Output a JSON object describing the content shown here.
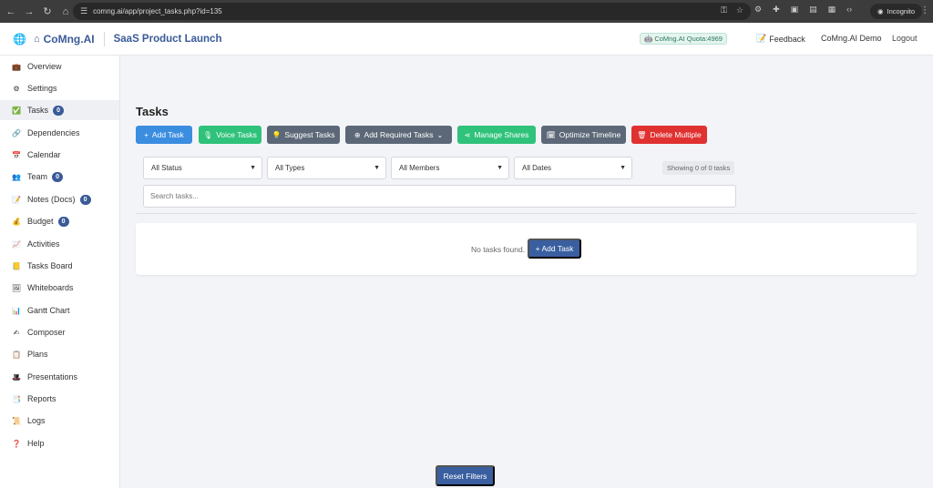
{
  "browser": {
    "url": "comng.ai/app/project_tasks.php?id=135",
    "incognito_label": "Incognito"
  },
  "header": {
    "brand": "CoMng.AI",
    "project": "SaaS Product Launch",
    "quota": "CoMng.AI Quota:4969",
    "feedback": "Feedback",
    "user": "CoMng.AI Demo",
    "logout": "Logout"
  },
  "sidebar": {
    "items": [
      {
        "label": "Overview",
        "icon": "briefcase-icon",
        "glyph": "💼"
      },
      {
        "label": "Settings",
        "icon": "gear-icon",
        "glyph": "⚙"
      },
      {
        "label": "Tasks",
        "icon": "checkbox-icon",
        "glyph": "✅",
        "badge": "0"
      },
      {
        "label": "Dependencies",
        "icon": "link-icon",
        "glyph": "🔗"
      },
      {
        "label": "Calendar",
        "icon": "calendar-icon",
        "glyph": "📅"
      },
      {
        "label": "Team",
        "icon": "team-icon",
        "glyph": "👥",
        "badge": "0"
      },
      {
        "label": "Notes (Docs)",
        "icon": "notes-icon",
        "glyph": "📝",
        "badge": "0"
      },
      {
        "label": "Budget",
        "icon": "money-bag-icon",
        "glyph": "💰",
        "badge": "0"
      },
      {
        "label": "Activities",
        "icon": "chart-icon",
        "glyph": "📈"
      },
      {
        "label": "Tasks Board",
        "icon": "sticky-note-icon",
        "glyph": "📒"
      },
      {
        "label": "Whiteboards",
        "icon": "whiteboard-icon",
        "glyph": "🖼"
      },
      {
        "label": "Gantt Chart",
        "icon": "bar-chart-icon",
        "glyph": "📊"
      },
      {
        "label": "Composer",
        "icon": "composer-icon",
        "glyph": "✍"
      },
      {
        "label": "Plans",
        "icon": "clipboard-icon",
        "glyph": "📋"
      },
      {
        "label": "Presentations",
        "icon": "presentation-icon",
        "glyph": "🎩"
      },
      {
        "label": "Reports",
        "icon": "report-icon",
        "glyph": "📑"
      },
      {
        "label": "Logs",
        "icon": "logs-icon",
        "glyph": "📜"
      },
      {
        "label": "Help",
        "icon": "help-icon",
        "glyph": "❓"
      }
    ]
  },
  "main": {
    "title": "Tasks",
    "buttons": {
      "add_task": "Add Task",
      "voice_tasks": "Voice Tasks",
      "suggest_tasks": "Suggest Tasks",
      "add_required_tasks": "Add Required Tasks",
      "manage_shares": "Manage Shares",
      "optimize_timeline": "Optimize Timeline",
      "delete_multiple": "Delete Multiple"
    },
    "filters": {
      "status": "All Status",
      "types": "All Types",
      "members": "All Members",
      "dates": "All Dates",
      "showing": "Showing 0 of 0 tasks",
      "search_placeholder": "Search tasks..."
    },
    "empty": {
      "text": "No tasks found.",
      "add_button": "+ Add Task"
    },
    "reset_filters": "Reset Filters"
  },
  "colors": {
    "brand": "#3a5a98",
    "blue": "#3b8de0",
    "green": "#2fc27a",
    "gray": "#5c6877",
    "red": "#e03131"
  }
}
